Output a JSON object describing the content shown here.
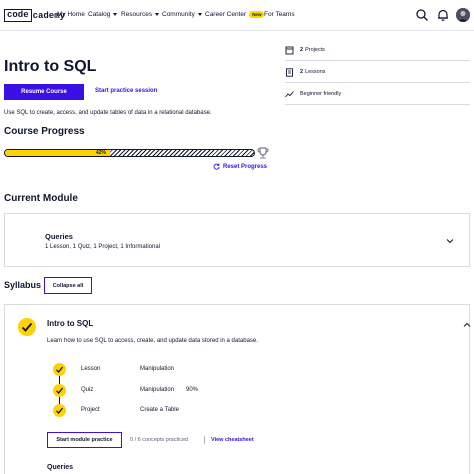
{
  "nav": {
    "logo_box": "code",
    "logo_rest": "cademy",
    "items": [
      {
        "label": "My Home"
      },
      {
        "label": "Catalog"
      },
      {
        "label": "Resources"
      },
      {
        "label": "Community"
      },
      {
        "label": "Career Center"
      },
      {
        "label": "For Teams"
      }
    ],
    "new_badge": "New",
    "icons": [
      "search-icon",
      "bell-icon",
      "avatar"
    ]
  },
  "course": {
    "title": "Intro to SQL",
    "resume_label": "Resume Course",
    "practice_label": "Start practice session",
    "description": "Use SQL to create, access, and update tables of data in a relational database."
  },
  "side_info": [
    {
      "icon": "projects-icon",
      "count": "2",
      "text": "Projects"
    },
    {
      "icon": "lessons-icon",
      "count": "2",
      "text": "Lessons"
    },
    {
      "icon": "level-icon",
      "count": "",
      "text": "Beginner friendly"
    }
  ],
  "progress": {
    "heading": "Course Progress",
    "percent": 42,
    "percent_label": "42%",
    "reset_label": "Reset Progress"
  },
  "current_module": {
    "heading": "Current Module",
    "name": "Queries",
    "meta": "1 Lesson, 1 Quiz, 1 Project, 1 Informational"
  },
  "syllabus": {
    "heading": "Syllabus",
    "collapse_label": "Collapse all",
    "module": {
      "name": "Intro to SQL",
      "description": "Learn how to use SQL to access, create, and update data stored in a database.",
      "items": [
        {
          "type": "Lesson",
          "label": "Manipulation",
          "score": ""
        },
        {
          "type": "Quiz",
          "label": "Manipulation",
          "score": "90%"
        },
        {
          "type": "Project",
          "label": "Create a Table",
          "score": ""
        }
      ],
      "practice_label": "Start module practice",
      "concepts_text": "0 / 6 concepts practiced",
      "cheatsheet_label": "View cheatsheet"
    },
    "next_module_name": "Queries"
  },
  "colors": {
    "accent": "#3a10e5",
    "highlight": "#ffd300",
    "text": "#10162f",
    "hero_bg": "#ffffff"
  }
}
